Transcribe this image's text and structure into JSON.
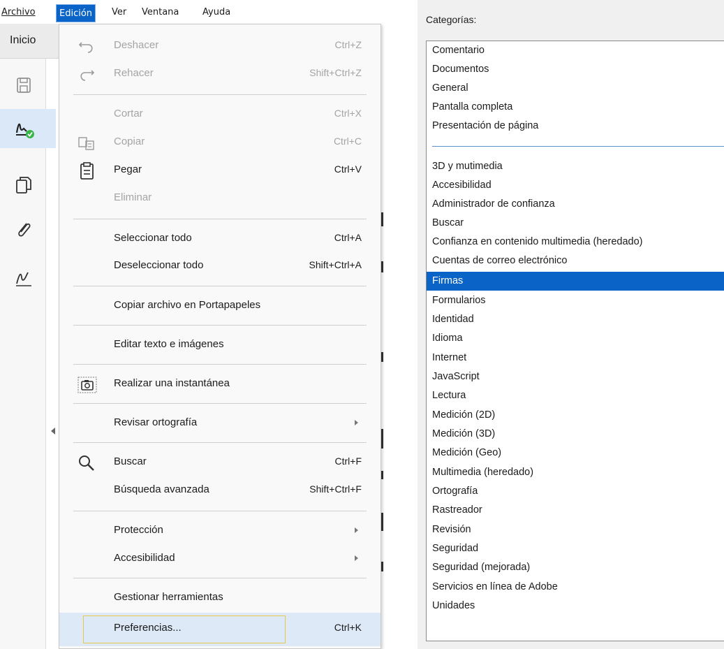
{
  "menubar": {
    "items": [
      {
        "label": "Archivo"
      },
      {
        "label": "Edición"
      },
      {
        "label": "Ver"
      },
      {
        "label": "Ventana"
      },
      {
        "label": "Ayuda"
      }
    ]
  },
  "app": {
    "tab_label": "Inicio"
  },
  "menu": {
    "items": [
      {
        "label": "Deshacer",
        "shortcut": "Ctrl+Z",
        "enabled": false,
        "icon": "undo-icon"
      },
      {
        "label": "Rehacer",
        "shortcut": "Shift+Ctrl+Z",
        "enabled": false,
        "icon": "redo-icon"
      },
      {
        "label": "Cortar",
        "shortcut": "Ctrl+X",
        "enabled": false
      },
      {
        "label": "Copiar",
        "shortcut": "Ctrl+C",
        "enabled": false,
        "icon": "copy-icon"
      },
      {
        "label": "Pegar",
        "shortcut": "Ctrl+V",
        "enabled": true,
        "icon": "paste-icon"
      },
      {
        "label": "Eliminar",
        "shortcut": "",
        "enabled": false
      },
      {
        "label": "Seleccionar todo",
        "shortcut": "Ctrl+A",
        "enabled": true
      },
      {
        "label": "Deseleccionar todo",
        "shortcut": "Shift+Ctrl+A",
        "enabled": true
      },
      {
        "label": "Copiar archivo en Portapapeles",
        "shortcut": "",
        "enabled": true
      },
      {
        "label": "Editar texto e imágenes",
        "shortcut": "",
        "enabled": true
      },
      {
        "label": "Realizar una instantánea",
        "shortcut": "",
        "enabled": true,
        "icon": "snapshot-icon"
      },
      {
        "label": "Revisar ortografía",
        "shortcut": "",
        "enabled": true,
        "submenu": true
      },
      {
        "label": "Buscar",
        "shortcut": "Ctrl+F",
        "enabled": true,
        "icon": "search-icon"
      },
      {
        "label": "Búsqueda avanzada",
        "shortcut": "Shift+Ctrl+F",
        "enabled": true
      },
      {
        "label": "Protección",
        "shortcut": "",
        "enabled": true,
        "submenu": true
      },
      {
        "label": "Accesibilidad",
        "shortcut": "",
        "enabled": true,
        "submenu": true
      },
      {
        "label": "Gestionar herramientas",
        "shortcut": "",
        "enabled": true
      },
      {
        "label": "Preferencias...",
        "shortcut": "Ctrl+K",
        "enabled": true,
        "highlighted": true
      }
    ]
  },
  "preferences": {
    "categories_label": "Categorías:",
    "top_group": [
      "Comentario",
      "Documentos",
      "General",
      "Pantalla completa",
      "Presentación de página"
    ],
    "bottom_group": [
      "3D y mutimedia",
      "Accesibilidad",
      "Administrador de confianza",
      "Buscar",
      "Confianza en contenido multimedia (heredado)",
      "Cuentas de correo electrónico",
      "Firmas",
      "Formularios",
      "Identidad",
      "Idioma",
      "Internet",
      "JavaScript",
      "Lectura",
      "Medición (2D)",
      "Medición (3D)",
      "Medición (Geo)",
      "Multimedia (heredado)",
      "Ortografía",
      "Rastreador",
      "Revisión",
      "Seguridad",
      "Seguridad (mejorada)",
      "Servicios en línea de Adobe",
      "Unidades"
    ],
    "selected": "Firmas"
  },
  "colors": {
    "accent": "#0a64c8",
    "menu_highlight": "#dde9f7",
    "focus_border": "#e7c94a",
    "disabled_text": "#a4a4a4"
  }
}
